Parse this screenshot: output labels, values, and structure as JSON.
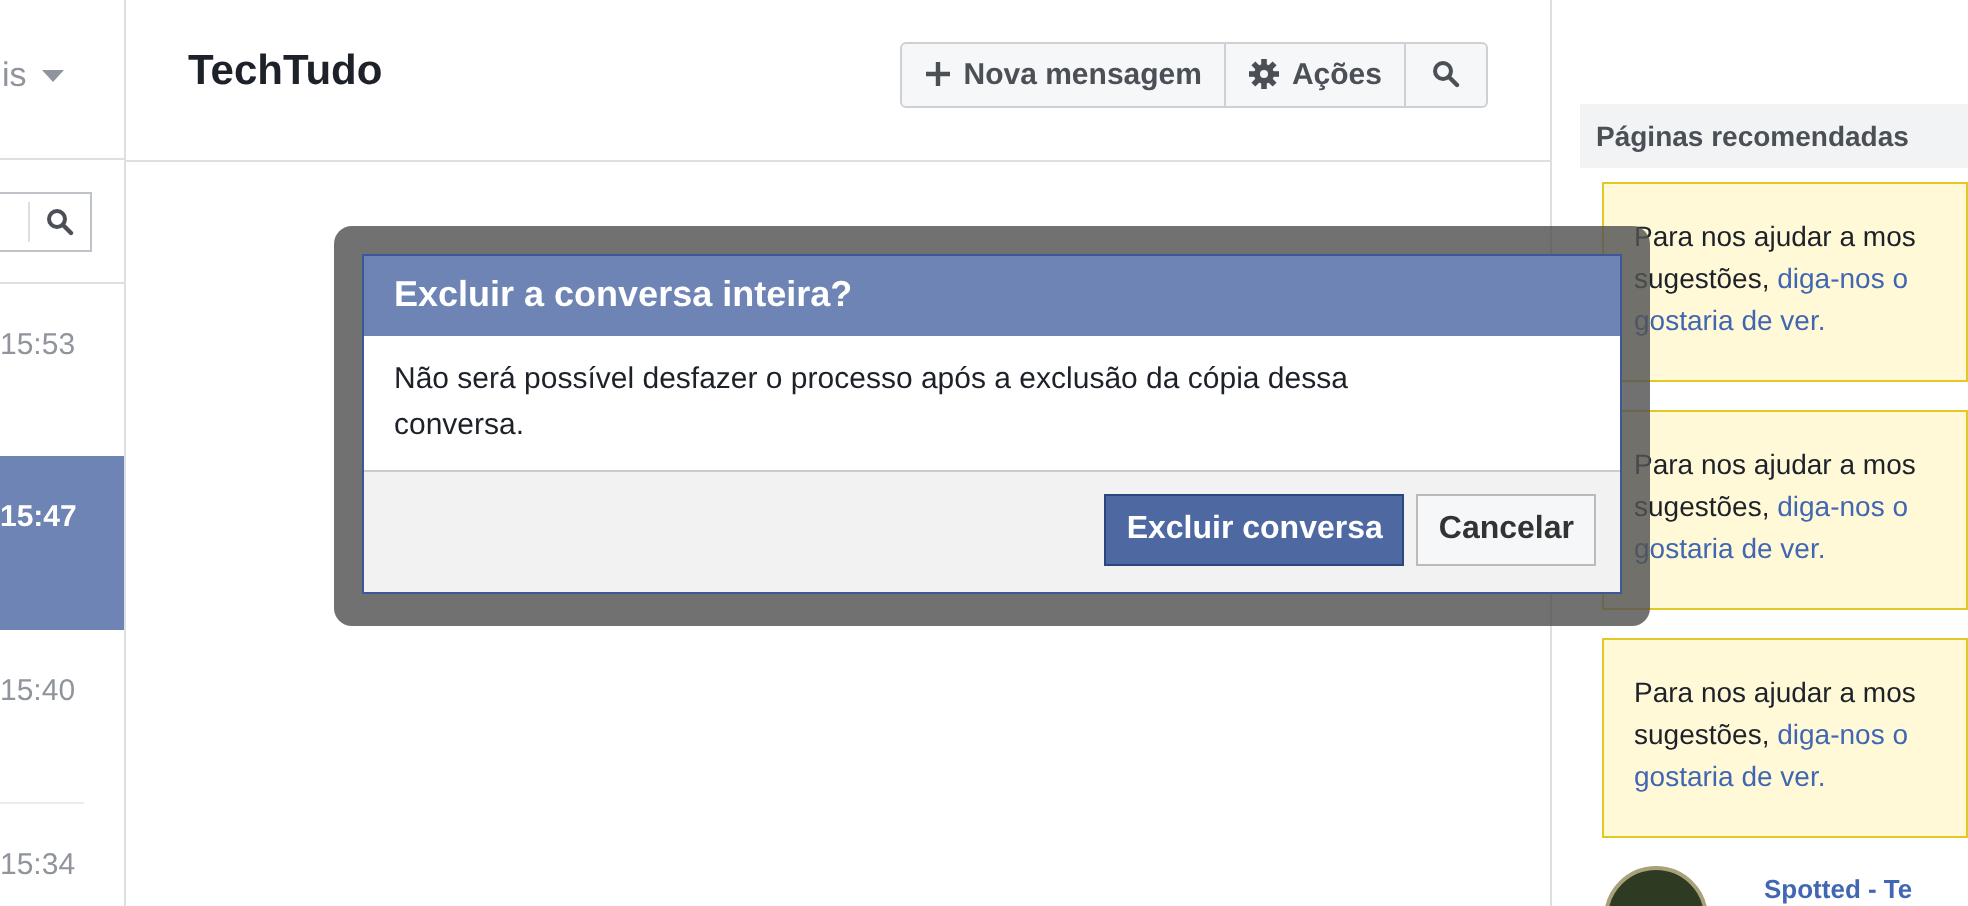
{
  "left_column": {
    "header_fragment": "is",
    "conversations": [
      {
        "time": "15:53",
        "selected": false
      },
      {
        "time": "15:47",
        "selected": true
      },
      {
        "time": "15:40",
        "selected": false
      },
      {
        "time": "15:34",
        "selected": false
      }
    ]
  },
  "header": {
    "title": "TechTudo",
    "buttons": [
      {
        "kind": "new",
        "label": "Nova mensagem"
      },
      {
        "kind": "actions",
        "label": "Ações"
      },
      {
        "kind": "search"
      }
    ]
  },
  "dialog": {
    "title": "Excluir a conversa inteira?",
    "message": "Não será possível desfazer o processo após a exclusão da cópia dessa conversa.",
    "buttons": [
      {
        "label": "Excluir conversa",
        "primary": true
      },
      {
        "label": "Cancelar",
        "primary": false
      }
    ]
  },
  "sidebar": {
    "title": "Páginas recomendadas",
    "notices": [
      {
        "text": "Para nos ajudar a mos",
        "prefix": "sugestões,",
        "link": "diga-nos o",
        "link_end": "gostaria de ver."
      },
      {
        "text": "Para nos ajudar a mos",
        "prefix": "sugestões,",
        "link": "diga-nos o",
        "link_end": "gostaria de ver."
      },
      {
        "text": "Para nos ajudar a mos",
        "prefix": "sugestões,",
        "link": "diga-nos o",
        "link_end": "gostaria de ver."
      }
    ],
    "pages": [
      {
        "name": "Spotted - Te"
      }
    ]
  }
}
